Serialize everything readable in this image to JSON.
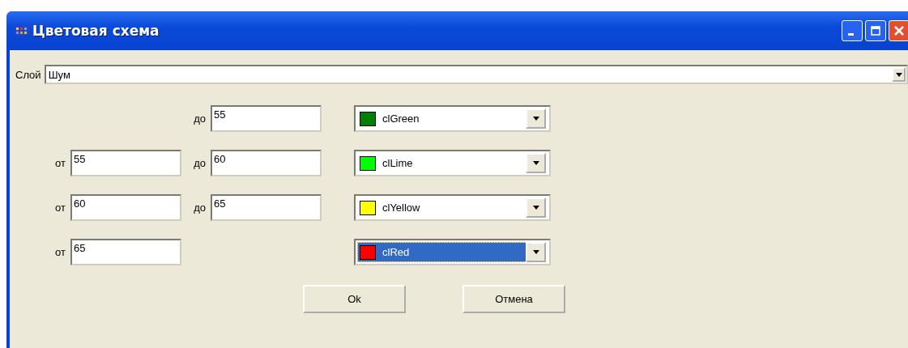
{
  "window": {
    "title": "Цветовая схема"
  },
  "layer": {
    "label": "Слой",
    "value": "Шум"
  },
  "ranges": [
    {
      "to_label": "до",
      "to": "55",
      "color": "#008000",
      "color_name": "clGreen",
      "selected": false
    },
    {
      "from_label": "от",
      "from": "55",
      "to_label": "до",
      "to": "60",
      "color": "#00ff00",
      "color_name": "clLime",
      "selected": false
    },
    {
      "from_label": "от",
      "from": "60",
      "to_label": "до",
      "to": "65",
      "color": "#ffff00",
      "color_name": "clYellow",
      "selected": false
    },
    {
      "from_label": "от",
      "from": "65",
      "color": "#ff0000",
      "color_name": "clRed",
      "selected": true
    }
  ],
  "buttons": [
    "Ok",
    "Отмена"
  ]
}
